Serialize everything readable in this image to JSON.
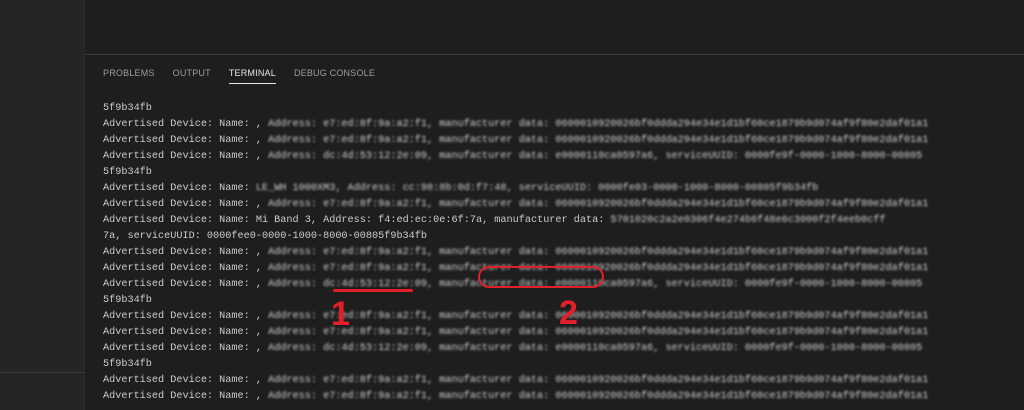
{
  "panel": {
    "tabs": [
      "PROBLEMS",
      "OUTPUT",
      "TERMINAL",
      "DEBUG CONSOLE"
    ],
    "active_tab": "TERMINAL"
  },
  "terminal": {
    "lines": [
      {
        "text": "5f9b34fb",
        "blurred": ""
      },
      {
        "text": "Advertised Device: Name: ,",
        "blurred": " Address: e7:ed:8f:9a:a2:f1, manufacturer data: 0600010920026bf0ddda294e34e1d1bf60ce1879b9d074af9f80e2daf01a1"
      },
      {
        "text": "Advertised Device: Name: ,",
        "blurred": " Address: e7:ed:8f:9a:a2:f1, manufacturer data: 0600010920026bf0ddda294e34e1d1bf60ce1879b9d074af9f80e2daf01a1"
      },
      {
        "text": "Advertised Device: Name: ,",
        "blurred": " Address: dc:4d:53:12:2e:09, manufacturer data: e0000110ca0597a6, serviceUUID: 0000fe9f-0000-1000-8000-00805"
      },
      {
        "text": "5f9b34fb",
        "blurred": ""
      },
      {
        "text": "Advertised Device: Name:",
        "blurred": " LE_WH 1000XM3, Address: cc:98:8b:0d:f7:48, serviceUUID: 0000fe03-0000-1000-8000-00805f9b34fb"
      },
      {
        "text": "Advertised Device: Name: ,",
        "blurred": " Address: e7:ed:8f:9a:a2:f1, manufacturer data: 0600010920026bf0ddda294e34e1d1bf60ce1879b9d074af9f80e2daf01a1"
      },
      {
        "text": "Advertised Device: Name: Mi Band 3, Address:",
        "highlight": "f4:ed:ec:0e:6f:7a",
        "after": ", manufacturer data:",
        "blurred": " 5701020c2a2e0306f4e274b6f48e6c3000f2f4eeb0cff"
      },
      {
        "text": "7a, serviceUUID: 0000fee0-0000-1000-8000-00805f9b34fb",
        "blurred": ""
      },
      {
        "text": "Advertised Device: Name: ,",
        "blurred": " Address: e7:ed:8f:9a:a2:f1, manufacturer data: 0600010920026bf0ddda294e34e1d1bf60ce1879b9d074af9f80e2daf01a1"
      },
      {
        "text": "Advertised Device: Name: ,",
        "blurred": " Address: e7:ed:8f:9a:a2:f1, manufacturer data: 0600010920026bf0ddda294e34e1d1bf60ce1879b9d074af9f80e2daf01a1"
      },
      {
        "text": "Advertised Device: Name: ,",
        "blurred": " Address: dc:4d:53:12:2e:09, manufacturer data: e0000110ca0597a6, serviceUUID: 0000fe9f-0000-1000-8000-00805"
      },
      {
        "text": "5f9b34fb",
        "blurred": ""
      },
      {
        "text": "Advertised Device: Name: ,",
        "blurred": " Address: e7:ed:8f:9a:a2:f1, manufacturer data: 0600010920026bf0ddda294e34e1d1bf60ce1879b9d074af9f80e2daf01a1"
      },
      {
        "text": "Advertised Device: Name: ,",
        "blurred": " Address: e7:ed:8f:9a:a2:f1, manufacturer data: 0600010920026bf0ddda294e34e1d1bf60ce1879b9d074af9f80e2daf01a1"
      },
      {
        "text": "Advertised Device: Name: ,",
        "blurred": " Address: dc:4d:53:12:2e:09, manufacturer data: e0000110ca0597a6, serviceUUID: 0000fe9f-0000-1000-8000-00805"
      },
      {
        "text": "5f9b34fb",
        "blurred": ""
      },
      {
        "text": "Advertised Device: Name: ,",
        "blurred": " Address: e7:ed:8f:9a:a2:f1, manufacturer data: 0600010920026bf0ddda294e34e1d1bf60ce1879b9d074af9f80e2daf01a1"
      },
      {
        "text": "Advertised Device: Name: ,",
        "blurred": " Address: e7:ed:8f:9a:a2:f1, manufacturer data: 0600010920026bf0ddda294e34e1d1bf60ce1879b9d074af9f80e2daf01a1"
      }
    ]
  },
  "annotations": {
    "label_1": "1",
    "label_2": "2",
    "color": "#e31f2a"
  }
}
